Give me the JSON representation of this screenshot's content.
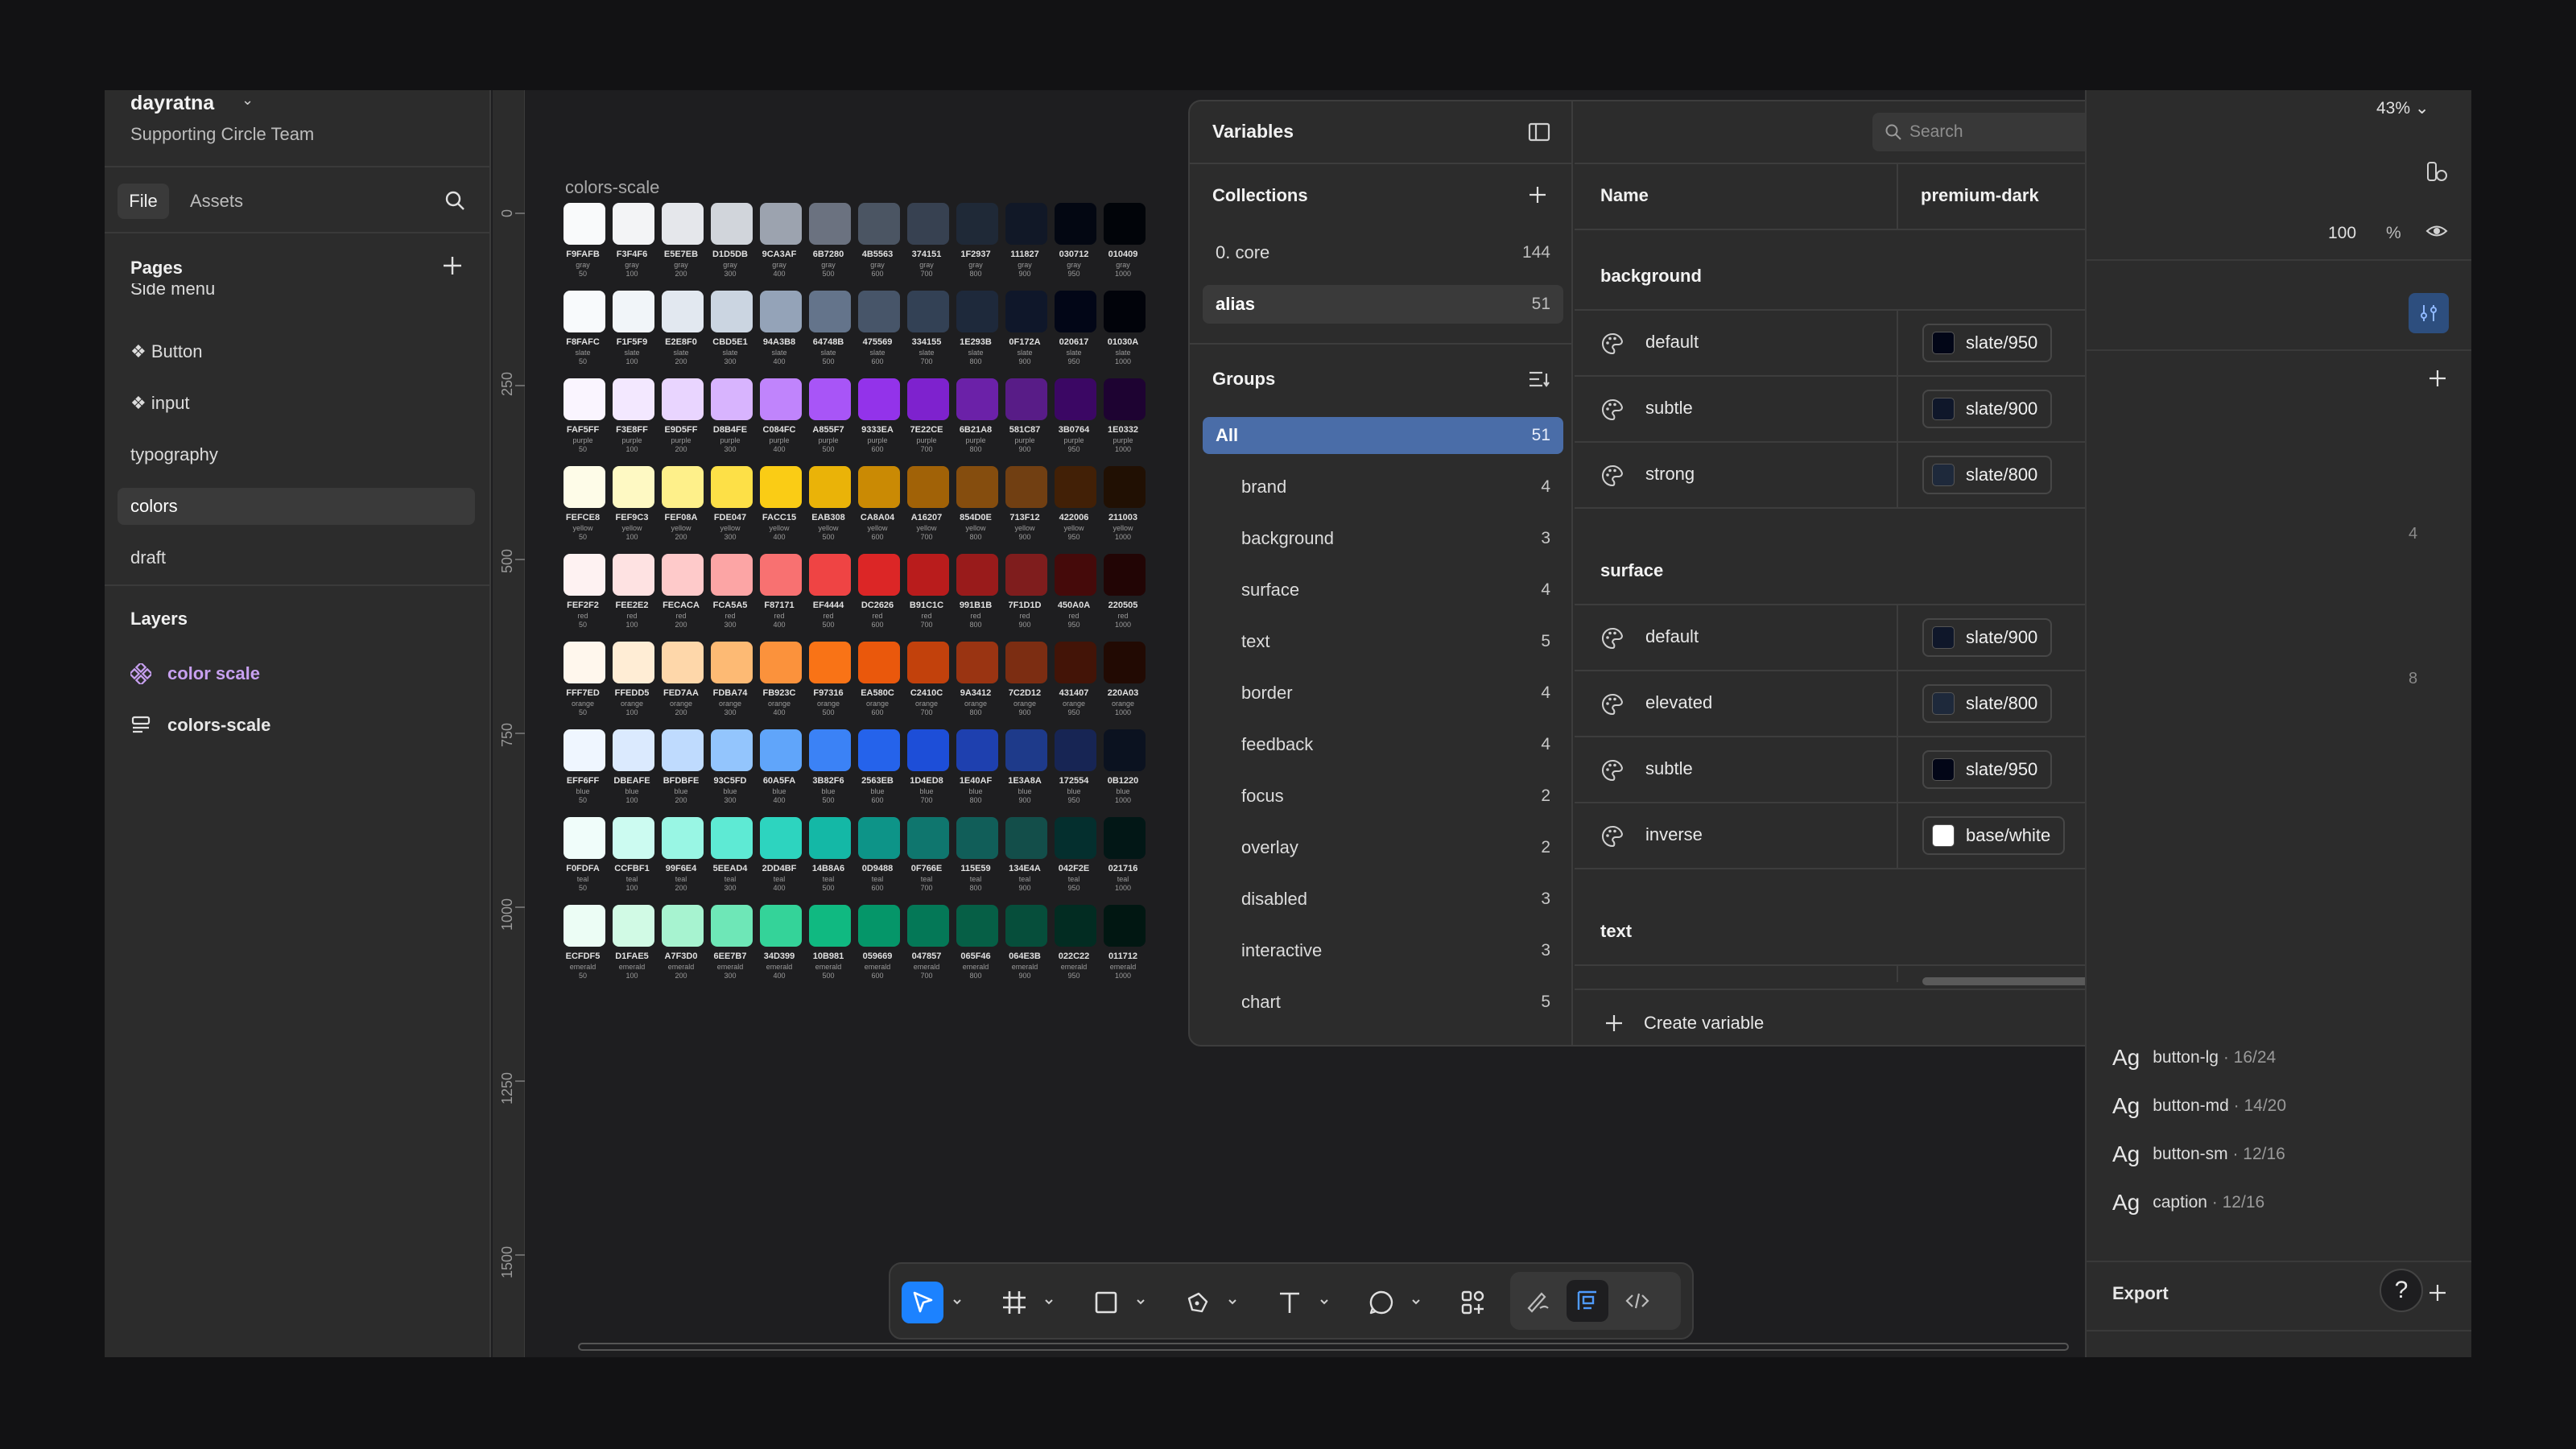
{
  "workspace": {
    "name": "dayratna",
    "team": "Supporting Circle Team"
  },
  "left_tabs": {
    "file": "File",
    "assets": "Assets"
  },
  "pages": {
    "title": "Pages",
    "items": [
      {
        "label": "Side menu",
        "glyph": "",
        "selected": false
      },
      {
        "label": "❖ Button",
        "selected": false
      },
      {
        "label": "❖ input",
        "selected": false
      },
      {
        "label": "typography",
        "selected": false
      },
      {
        "label": "colors",
        "selected": true
      },
      {
        "label": "draft",
        "selected": false
      }
    ]
  },
  "layers": {
    "title": "Layers",
    "items": [
      {
        "label": "color scale",
        "icon": "component-icon",
        "color": "#c7a0f0"
      },
      {
        "label": "colors-scale",
        "icon": "text-frame-icon",
        "color": "#e8e8e8"
      }
    ]
  },
  "ruler": {
    "labels": [
      "0",
      "250",
      "500",
      "750",
      "1000",
      "1250",
      "1500"
    ]
  },
  "frame": {
    "title": "colors-scale",
    "rows": [
      {
        "name": "gray",
        "hexes": [
          "F9FAFB",
          "F3F4F6",
          "E5E7EB",
          "D1D5DB",
          "9CA3AF",
          "6B7280",
          "4B5563",
          "374151",
          "1F2937",
          "111827",
          "030712",
          "010409"
        ]
      },
      {
        "name": "slate",
        "hexes": [
          "F8FAFC",
          "F1F5F9",
          "E2E8F0",
          "CBD5E1",
          "94A3B8",
          "64748B",
          "475569",
          "334155",
          "1E293B",
          "0F172A",
          "020617",
          "01030A"
        ]
      },
      {
        "name": "purple",
        "hexes": [
          "FAF5FF",
          "F3E8FF",
          "E9D5FF",
          "D8B4FE",
          "C084FC",
          "A855F7",
          "9333EA",
          "7E22CE",
          "6B21A8",
          "581C87",
          "3B0764",
          "1E0332"
        ]
      },
      {
        "name": "yellow",
        "hexes": [
          "FEFCE8",
          "FEF9C3",
          "FEF08A",
          "FDE047",
          "FACC15",
          "EAB308",
          "CA8A04",
          "A16207",
          "854D0E",
          "713F12",
          "422006",
          "211003"
        ]
      },
      {
        "name": "red",
        "hexes": [
          "FEF2F2",
          "FEE2E2",
          "FECACA",
          "FCA5A5",
          "F87171",
          "EF4444",
          "DC2626",
          "B91C1C",
          "991B1B",
          "7F1D1D",
          "450A0A",
          "220505"
        ]
      },
      {
        "name": "orange",
        "hexes": [
          "FFF7ED",
          "FFEDD5",
          "FED7AA",
          "FDBA74",
          "FB923C",
          "F97316",
          "EA580C",
          "C2410C",
          "9A3412",
          "7C2D12",
          "431407",
          "220A03"
        ]
      },
      {
        "name": "blue",
        "hexes": [
          "EFF6FF",
          "DBEAFE",
          "BFDBFE",
          "93C5FD",
          "60A5FA",
          "3B82F6",
          "2563EB",
          "1D4ED8",
          "1E40AF",
          "1E3A8A",
          "172554",
          "0B1220"
        ]
      },
      {
        "name": "teal",
        "hexes": [
          "F0FDFA",
          "CCFBF1",
          "99F6E4",
          "5EEAD4",
          "2DD4BF",
          "14B8A6",
          "0D9488",
          "0F766E",
          "115E59",
          "134E4A",
          "042F2E",
          "021716"
        ]
      },
      {
        "name": "emerald",
        "hexes": [
          "ECFDF5",
          "D1FAE5",
          "A7F3D0",
          "6EE7B7",
          "34D399",
          "10B981",
          "059669",
          "047857",
          "065F46",
          "064E3B",
          "022C22",
          "011712"
        ]
      }
    ],
    "steps": [
      "50",
      "100",
      "200",
      "300",
      "400",
      "500",
      "600",
      "700",
      "800",
      "900",
      "950",
      "1000"
    ]
  },
  "variables": {
    "title": "Variables",
    "collections_title": "Collections",
    "collections": [
      {
        "label": "0. core",
        "count": "144",
        "selected": false
      },
      {
        "label": "alias",
        "count": "51",
        "selected": true
      }
    ],
    "groups_title": "Groups",
    "groups": [
      {
        "label": "All",
        "count": "51",
        "all": true
      },
      {
        "label": "brand",
        "count": "4"
      },
      {
        "label": "background",
        "count": "3"
      },
      {
        "label": "surface",
        "count": "4"
      },
      {
        "label": "text",
        "count": "5"
      },
      {
        "label": "border",
        "count": "4"
      },
      {
        "label": "feedback",
        "count": "4"
      },
      {
        "label": "focus",
        "count": "2"
      },
      {
        "label": "overlay",
        "count": "2"
      },
      {
        "label": "disabled",
        "count": "3"
      },
      {
        "label": "interactive",
        "count": "3"
      },
      {
        "label": "chart",
        "count": "5"
      }
    ],
    "search_placeholder": "Search",
    "col_name": "Name",
    "col_mode": "premium-dark",
    "sections": [
      {
        "title": "background",
        "rows": [
          {
            "name": "default",
            "value": "slate/950",
            "color": "#020617"
          },
          {
            "name": "subtle",
            "value": "slate/900",
            "color": "#0F172A"
          },
          {
            "name": "strong",
            "value": "slate/800",
            "color": "#1E293B"
          }
        ]
      },
      {
        "title": "surface",
        "rows": [
          {
            "name": "default",
            "value": "slate/900",
            "color": "#0F172A"
          },
          {
            "name": "elevated",
            "value": "slate/800",
            "color": "#1E293B"
          },
          {
            "name": "subtle",
            "value": "slate/950",
            "color": "#020617"
          },
          {
            "name": "inverse",
            "value": "base/white",
            "color": "#FFFFFF"
          }
        ]
      },
      {
        "title": "text",
        "rows": []
      }
    ],
    "create_label": "Create variable"
  },
  "right_panel": {
    "zoom": "43%",
    "opacity_value": "100",
    "opacity_unit": "%",
    "text_styles": [
      {
        "ag": "Ag",
        "name": "button-lg",
        "meta": " · 16/24"
      },
      {
        "ag": "Ag",
        "name": "button-md",
        "meta": " · 14/20"
      },
      {
        "ag": "Ag",
        "name": "button-sm",
        "meta": " · 12/16"
      },
      {
        "ag": "Ag",
        "name": "caption",
        "meta": " · 12/16"
      }
    ],
    "export_label": "Export",
    "help_label": "?"
  },
  "toolbar": {
    "tools": [
      "move-tool",
      "frame-tool",
      "rectangle-tool",
      "pen-tool",
      "text-tool",
      "comment-tool",
      "actions-tool"
    ],
    "accent": "#1C82FF"
  }
}
